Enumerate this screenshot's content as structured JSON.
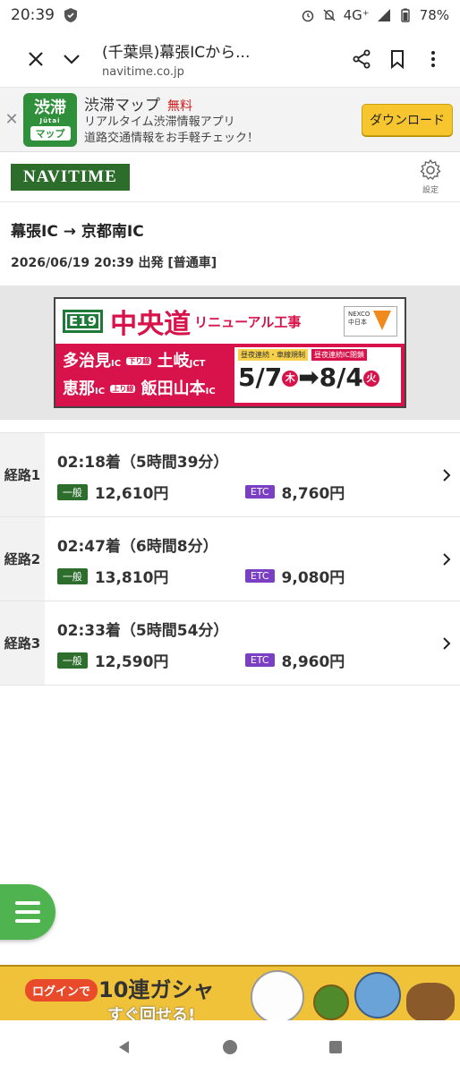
{
  "status": {
    "time": "20:39",
    "network": "4G⁺",
    "battery": "78%",
    "icons": [
      "shield-icon",
      "alarm-icon",
      "mute-icon",
      "signal-icon",
      "battery-icon"
    ]
  },
  "browser": {
    "title": "(千葉県)幕張ICから...",
    "domain": "navitime.co.jp"
  },
  "app_banner": {
    "icon_top": "渋滞",
    "icon_mid": "Jūtai",
    "icon_bottom": "マップ",
    "name": "渋滞マップ",
    "price": "無料",
    "line1": "リアルタイム渋滞情報アプリ",
    "line2": "道路交通情報をお手軽チェック！",
    "download_label": "ダウンロード"
  },
  "header": {
    "logo": "NAVITIME",
    "settings_label": "設定"
  },
  "summary": {
    "route": "幕張IC → 京都南IC",
    "departure": "2026/06/19 20:39 出発 [普通車]"
  },
  "ad": {
    "badge": "E19",
    "road": "中央道",
    "renewal": "リニューアル工事",
    "brand": "NEXCO",
    "brand_sub": "中日本",
    "sec1_from": "多治見",
    "sec1_ic": "IC",
    "sec1_dir": "下り線",
    "sec1_to": "土岐",
    "sec1_jct": "JCT",
    "sec2_from": "恵那",
    "sec2_ic": "IC",
    "sec2_dir": "上り線",
    "sec2_to": "飯田山本",
    "sec2_ic2": "IC",
    "tag1": "昼夜連続・車線規制",
    "tag2": "昼夜連続IC閉鎖",
    "date_start": "5/7",
    "day_start": "木",
    "date_end": "8/4",
    "day_end": "火"
  },
  "routes": [
    {
      "label": "経路1",
      "arrival": "02:18着（5時間39分）",
      "general_label": "一般",
      "general": "12,610円",
      "etc_label": "ETC",
      "etc": "8,760円"
    },
    {
      "label": "経路2",
      "arrival": "02:47着（6時間8分）",
      "general_label": "一般",
      "general": "13,810円",
      "etc_label": "ETC",
      "etc": "9,080円"
    },
    {
      "label": "経路3",
      "arrival": "02:33着（5時間54分）",
      "general_label": "一般",
      "general": "12,590円",
      "etc_label": "ETC",
      "etc": "8,960円"
    }
  ],
  "bottom_ad": {
    "bubble": "ログインで",
    "headline": "10連ガシャ",
    "sub": "すぐ回せる!"
  },
  "colors": {
    "navitime_green": "#2c6d2c",
    "etc_purple": "#7b3fc4",
    "fab_green": "#4fb44f",
    "download_yellow": "#f7c62f"
  }
}
